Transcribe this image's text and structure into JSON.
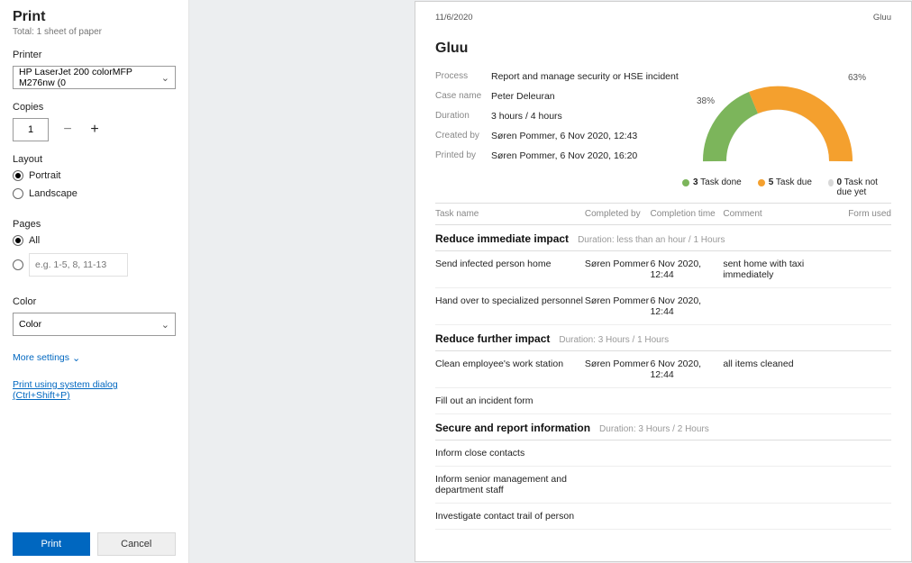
{
  "panel": {
    "title": "Print",
    "subtitle": "Total: 1 sheet of paper",
    "printer_label": "Printer",
    "printer_value": "HP LaserJet 200 colorMFP M276nw (0",
    "copies_label": "Copies",
    "copies_value": "1",
    "layout_label": "Layout",
    "layout_portrait": "Portrait",
    "layout_landscape": "Landscape",
    "pages_label": "Pages",
    "pages_all": "All",
    "pages_custom_placeholder": "e.g. 1-5, 8, 11-13",
    "color_label": "Color",
    "color_value": "Color",
    "more_settings": "More settings",
    "system_dialog": "Print using system dialog (Ctrl+Shift+P)",
    "print_btn": "Print",
    "cancel_btn": "Cancel"
  },
  "preview": {
    "header_date": "11/6/2020",
    "header_app": "Gluu",
    "title": "Gluu",
    "meta": {
      "process_k": "Process",
      "process_v": "Report and manage security or HSE incident",
      "case_k": "Case name",
      "case_v": "Peter Deleuran",
      "duration_k": "Duration",
      "duration_v": "3 hours / 4 hours",
      "created_k": "Created by",
      "created_v": "Søren Pommer, 6 Nov 2020, 12:43",
      "printed_k": "Printed by",
      "printed_v": "Søren Pommer, 6 Nov 2020, 16:20"
    },
    "chart": {
      "left_pct": "38%",
      "right_pct": "63%",
      "legend": [
        {
          "n": "3",
          "label": "Task done",
          "color": "#7cb55b"
        },
        {
          "n": "5",
          "label": "Task due",
          "color": "#f4a02e"
        },
        {
          "n": "0",
          "label": "Task not due yet",
          "color": "#d8d8d8"
        }
      ]
    },
    "table": {
      "h_name": "Task name",
      "h_by": "Completed by",
      "h_time": "Completion time",
      "h_comm": "Comment",
      "h_form": "Form used"
    },
    "sections": [
      {
        "title": "Reduce immediate impact",
        "duration": "Duration: less than an hour / 1 Hours",
        "rows": [
          {
            "name": "Send infected person home",
            "by": "Søren Pommer",
            "time": "6 Nov 2020, 12:44",
            "comment": "sent home with taxi immediately",
            "form": ""
          },
          {
            "name": "Hand over to specialized personnel",
            "by": "Søren Pommer",
            "time": "6 Nov 2020, 12:44",
            "comment": "",
            "form": ""
          }
        ]
      },
      {
        "title": "Reduce further impact",
        "duration": "Duration: 3 Hours / 1 Hours",
        "rows": [
          {
            "name": "Clean employee's work station",
            "by": "Søren Pommer",
            "time": "6 Nov 2020, 12:44",
            "comment": "all items cleaned",
            "form": ""
          },
          {
            "name": "Fill out an incident form",
            "by": "",
            "time": "",
            "comment": "",
            "form": ""
          }
        ]
      },
      {
        "title": "Secure and report information",
        "duration": "Duration: 3 Hours / 2 Hours",
        "rows": [
          {
            "name": "Inform close contacts",
            "by": "",
            "time": "",
            "comment": "",
            "form": ""
          },
          {
            "name": "Inform senior management and department staff",
            "by": "",
            "time": "",
            "comment": "",
            "form": ""
          },
          {
            "name": "Investigate contact trail of person",
            "by": "",
            "time": "",
            "comment": "",
            "form": ""
          }
        ]
      }
    ]
  },
  "chart_data": {
    "type": "pie",
    "title": "Task completion",
    "series": [
      {
        "name": "Task done",
        "value": 3,
        "pct": 38,
        "color": "#7cb55b"
      },
      {
        "name": "Task due",
        "value": 5,
        "pct": 63,
        "color": "#f4a02e"
      },
      {
        "name": "Task not due yet",
        "value": 0,
        "pct": 0,
        "color": "#d8d8d8"
      }
    ]
  }
}
